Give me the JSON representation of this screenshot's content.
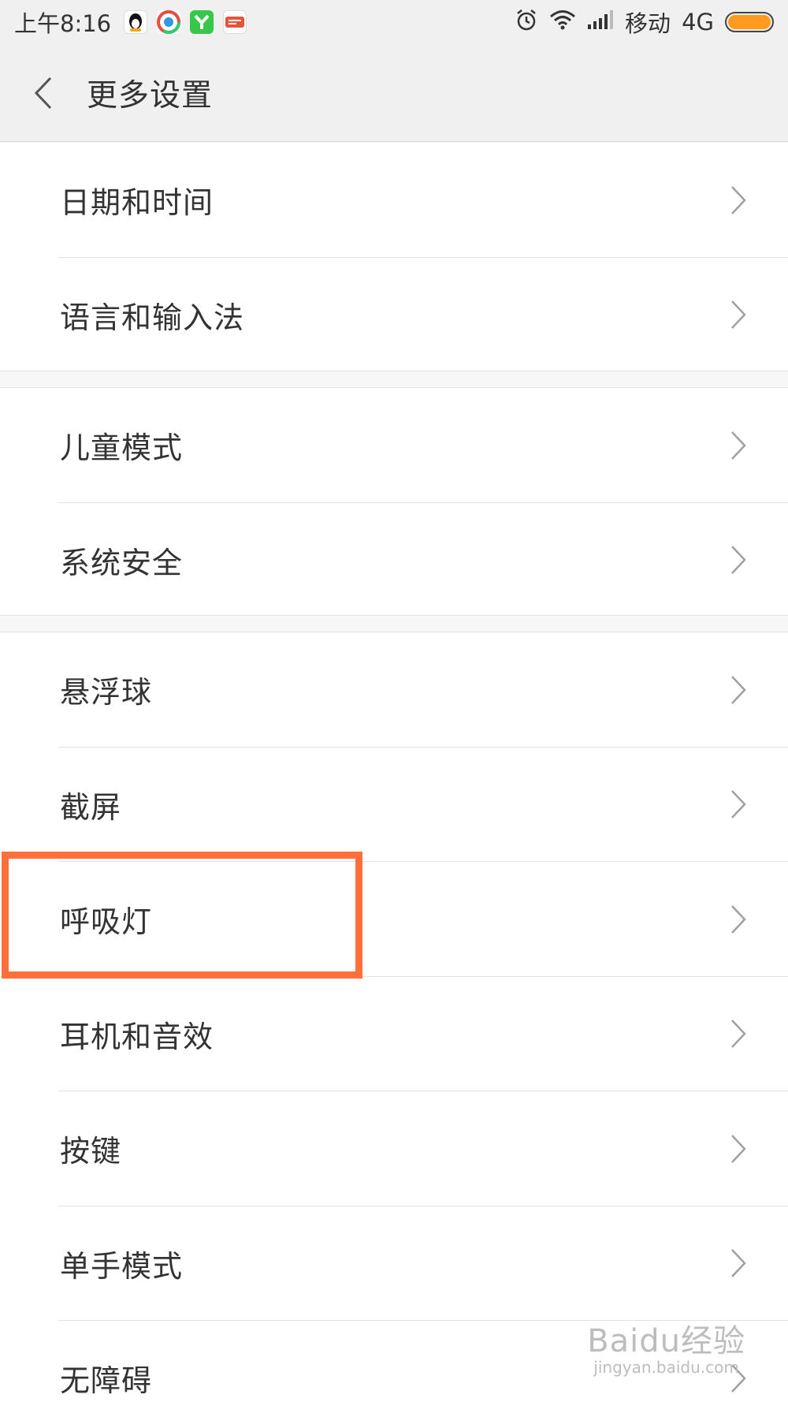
{
  "status_bar": {
    "time": "上午8:16",
    "notification_icons": [
      {
        "name": "qq-icon",
        "color": "#111111",
        "glyph": "🐧"
      },
      {
        "name": "browser-icon",
        "color": "#2e9be0",
        "glyph": "◉"
      },
      {
        "name": "y-app-icon",
        "color": "#38c74a",
        "glyph": "Y"
      },
      {
        "name": "news-app-icon",
        "color": "#e8533a",
        "glyph": "快报"
      }
    ],
    "carrier": "移动",
    "network": "4G",
    "battery_color": "#ff9a1e"
  },
  "header": {
    "back_icon": "chevron-left-icon",
    "title": "更多设置"
  },
  "groups": [
    {
      "items": [
        {
          "label": "日期和时间"
        },
        {
          "label": "语言和输入法"
        }
      ]
    },
    {
      "items": [
        {
          "label": "儿童模式"
        },
        {
          "label": "系统安全"
        }
      ]
    },
    {
      "items": [
        {
          "label": "悬浮球"
        },
        {
          "label": "截屏"
        },
        {
          "label": "呼吸灯"
        },
        {
          "label": "耳机和音效"
        },
        {
          "label": "按键"
        },
        {
          "label": "单手模式"
        },
        {
          "label": "无障碍"
        }
      ]
    }
  ],
  "highlight": {
    "target": "呼吸灯",
    "color": "#ff6f3c"
  },
  "watermark": {
    "main": "Baidu经验",
    "sub": "jingyan.baidu.com"
  }
}
